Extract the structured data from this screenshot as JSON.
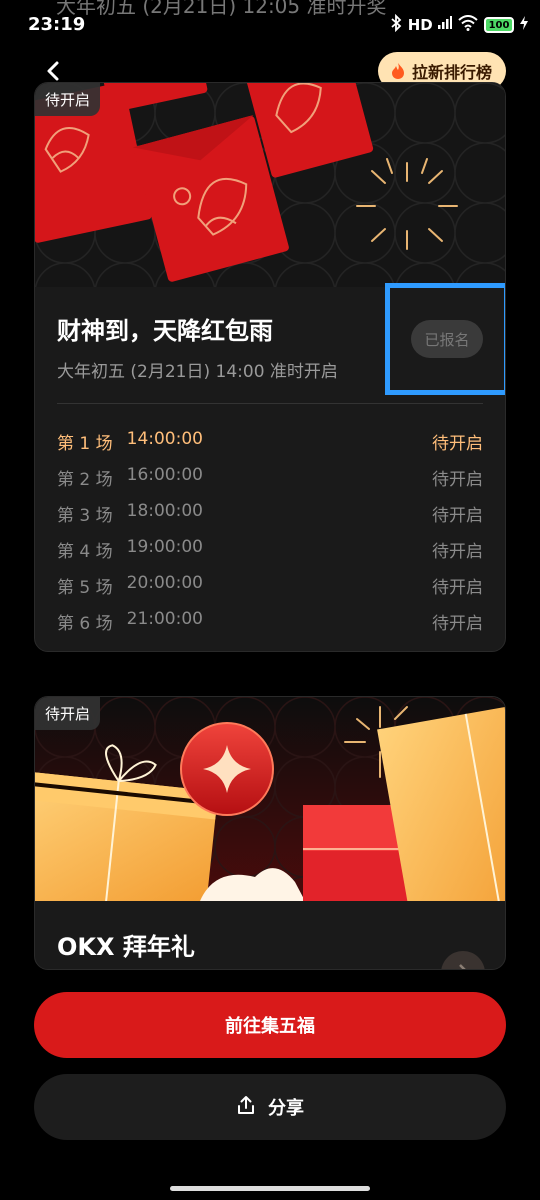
{
  "status_bar": {
    "time": "23:19",
    "ghost_text": "大年初五 (2月21日) 12:05 准时开奖",
    "battery": "100",
    "hd_label": "HD"
  },
  "header": {
    "rank_button_label": "拉新排行榜"
  },
  "card1": {
    "tag": "待开启",
    "title": "财神到，天降红包雨",
    "subtitle": "大年初五 (2月21日) 14:00 准时开启",
    "register_label": "已报名",
    "rounds": [
      {
        "name": "第 1 场",
        "time": "14:00:00",
        "status": "待开启"
      },
      {
        "name": "第 2 场",
        "time": "16:00:00",
        "status": "待开启"
      },
      {
        "name": "第 3 场",
        "time": "18:00:00",
        "status": "待开启"
      },
      {
        "name": "第 4 场",
        "time": "19:00:00",
        "status": "待开启"
      },
      {
        "name": "第 5 场",
        "time": "20:00:00",
        "status": "待开启"
      },
      {
        "name": "第 6 场",
        "time": "21:00:00",
        "status": "待开启"
      }
    ]
  },
  "card2": {
    "tag": "待开启",
    "title": "OKX 拜年礼"
  },
  "actions": {
    "main_label": "前往集五福",
    "share_label": "分享"
  },
  "colors": {
    "accent_red": "#d91a1a",
    "highlight_orange": "#ffbe7a",
    "rank_button_bg": "#ffe3b3",
    "selection_blue": "#2f9bff"
  }
}
